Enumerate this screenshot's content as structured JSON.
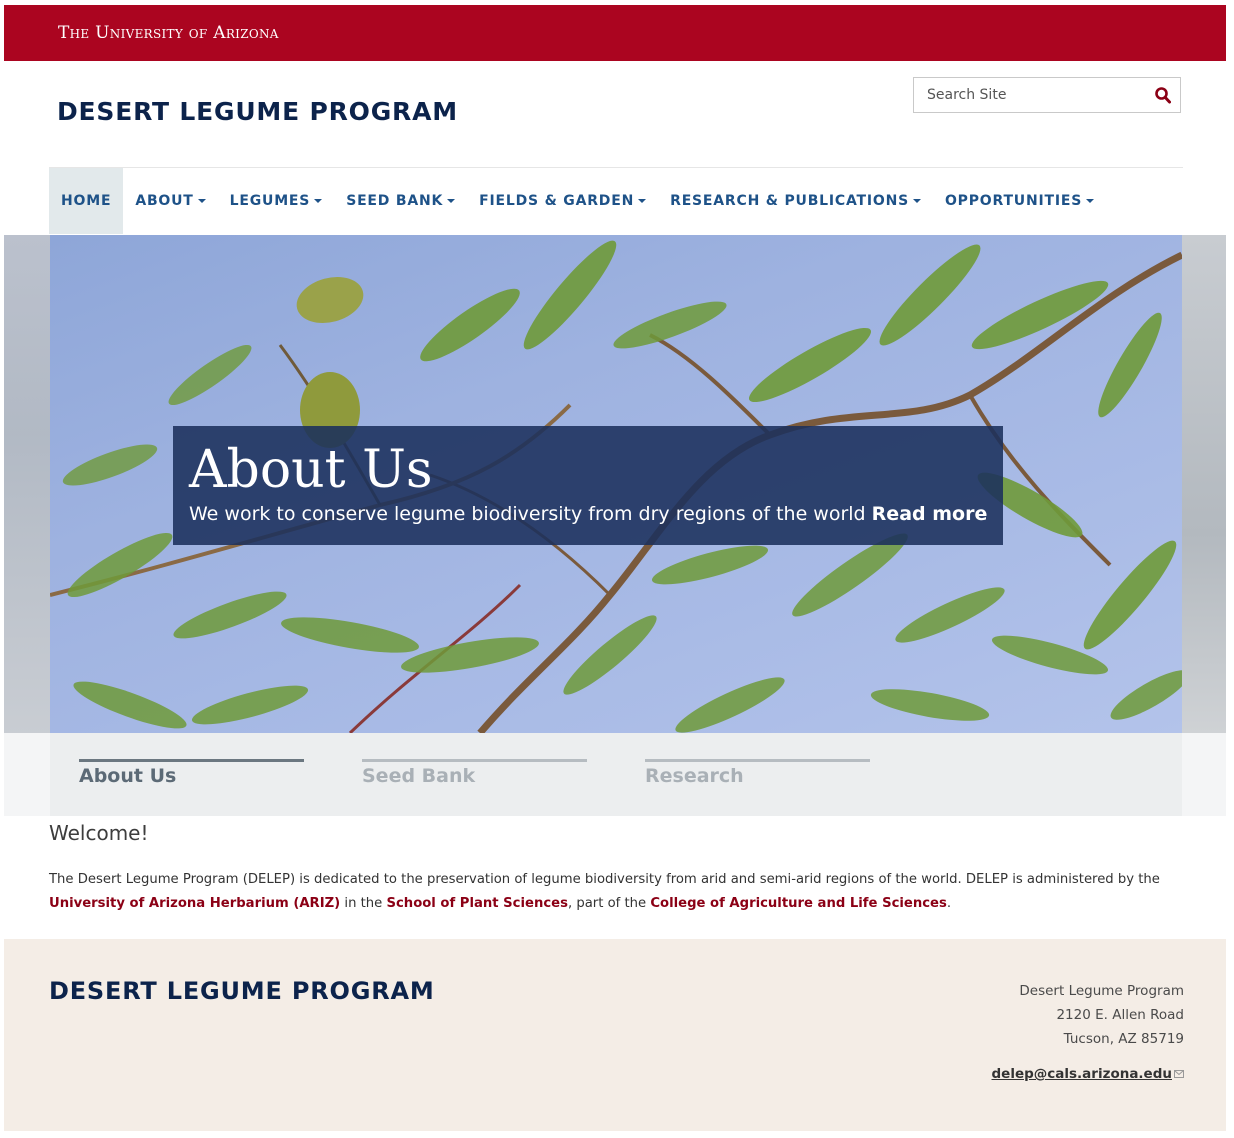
{
  "brand_bar": {
    "text": "The University of Arizona",
    "color": "#ab0520"
  },
  "header": {
    "site_title": "DESERT LEGUME PROGRAM",
    "search": {
      "placeholder": "Search Site",
      "icon": "search-icon"
    }
  },
  "nav": {
    "items": [
      {
        "label": "HOME",
        "active": true,
        "dropdown": false
      },
      {
        "label": "ABOUT",
        "active": false,
        "dropdown": true
      },
      {
        "label": "LEGUMES",
        "active": false,
        "dropdown": true
      },
      {
        "label": "SEED BANK",
        "active": false,
        "dropdown": true
      },
      {
        "label": "FIELDS & GARDEN",
        "active": false,
        "dropdown": true
      },
      {
        "label": "RESEARCH & PUBLICATIONS",
        "active": false,
        "dropdown": true
      },
      {
        "label": "OPPORTUNITIES",
        "active": false,
        "dropdown": true
      }
    ]
  },
  "hero": {
    "title": "About Us",
    "subtitle": "We work to conserve legume biodiversity from dry regions of the world",
    "link_label": "Read more"
  },
  "tabs": [
    {
      "label": "About Us",
      "active": true
    },
    {
      "label": "Seed Bank",
      "active": false
    },
    {
      "label": "Research",
      "active": false
    }
  ],
  "content": {
    "heading": "Welcome!",
    "intro": {
      "part1": "The Desert Legume Program (DELEP) is dedicated to the preservation of legume biodiversity from arid and semi-arid regions of the world. DELEP is administered by the",
      "link1": "University of Arizona Herbarium (ARIZ)",
      "part2": "in the",
      "link2": "School of Plant Sciences",
      "part3": ", part of the",
      "link3": "College of Agriculture and Life Sciences",
      "part4": "."
    }
  },
  "footer": {
    "title": "DESERT LEGUME PROGRAM",
    "address": [
      "Desert Legume Program",
      "2120 E. Allen Road",
      "Tucson, AZ 85719"
    ],
    "email": "delep@cals.arizona.edu"
  },
  "colors": {
    "brand_red": "#ab0520",
    "navy": "#0c234b",
    "nav_blue": "#1e5288",
    "link_red": "#8b0015",
    "footer_bg": "#f4ede6"
  }
}
